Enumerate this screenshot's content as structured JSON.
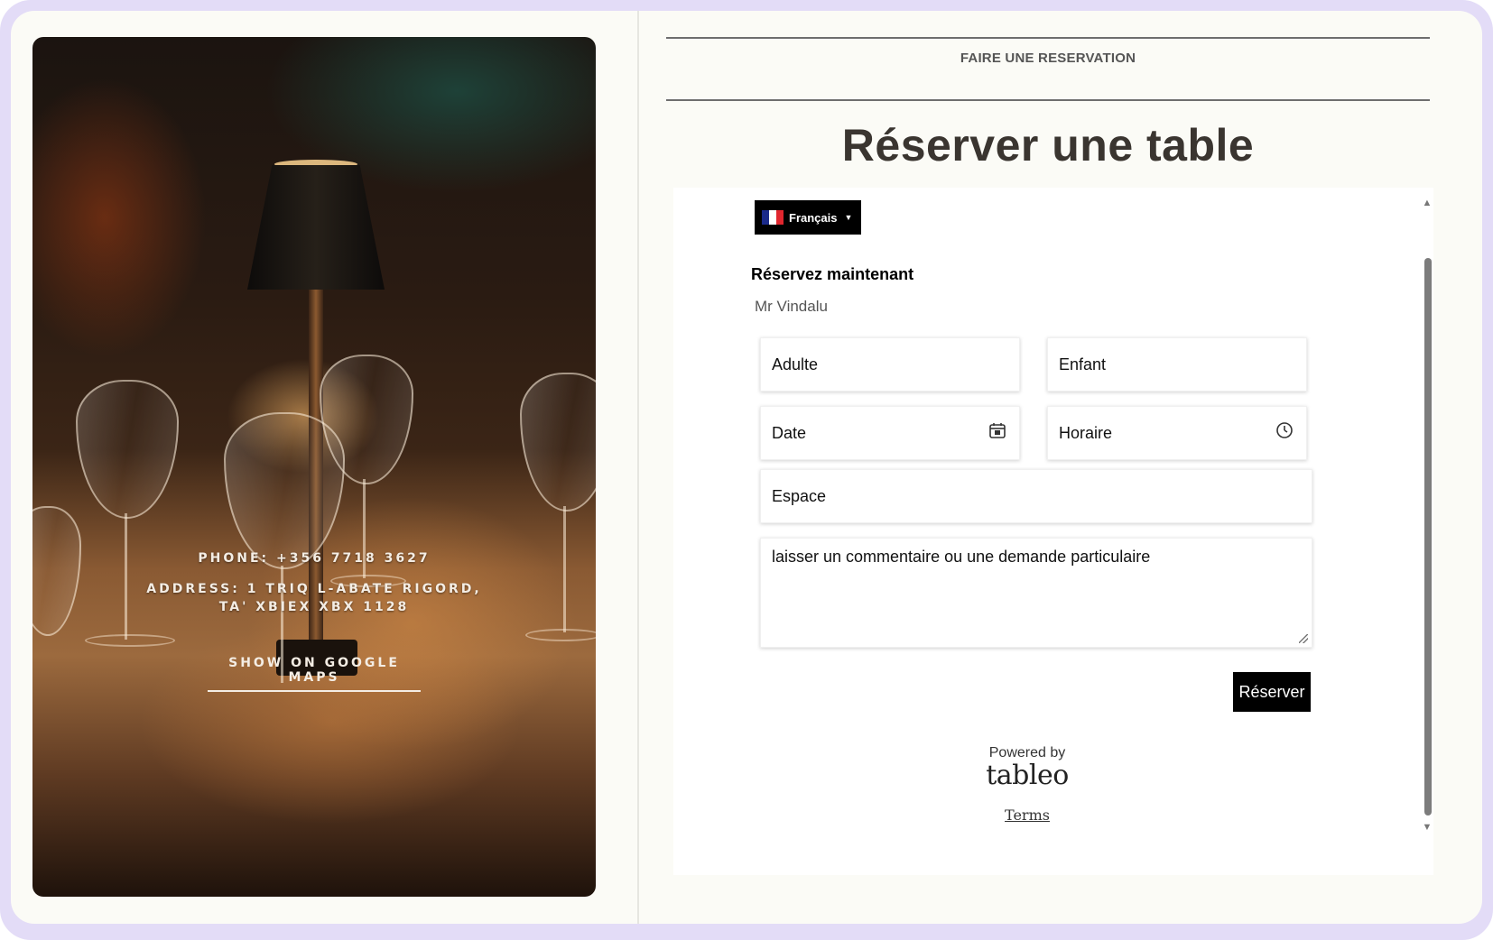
{
  "left_panel": {
    "phone": "PHONE: +356 7718 3627",
    "address_line1": "ADDRESS: 1 TRIQ L-ABATE RIGORD,",
    "address_line2": "TA' XBIEX XBX 1128",
    "maps_link": "SHOW ON GOOGLE MAPS"
  },
  "header": {
    "section_label": "FAIRE UNE RESERVATION",
    "title": "Réserver une table"
  },
  "widget": {
    "language": {
      "label": "Français",
      "flag": [
        "#1a2a8a",
        "#ffffff",
        "#e0262e"
      ]
    },
    "heading": "Réservez maintenant",
    "restaurant": "Mr Vindalu",
    "fields": {
      "adults": "Adulte",
      "children": "Enfant",
      "date": "Date",
      "time": "Horaire",
      "area": "Espace",
      "comment": "laisser un commentaire ou une demande particulaire"
    },
    "submit": "Réserver",
    "powered_by": "Powered by",
    "brand": "tableo",
    "terms": "Terms"
  },
  "icons": {
    "date": "calendar-icon",
    "time": "clock-icon",
    "language": "caret-down-icon"
  }
}
